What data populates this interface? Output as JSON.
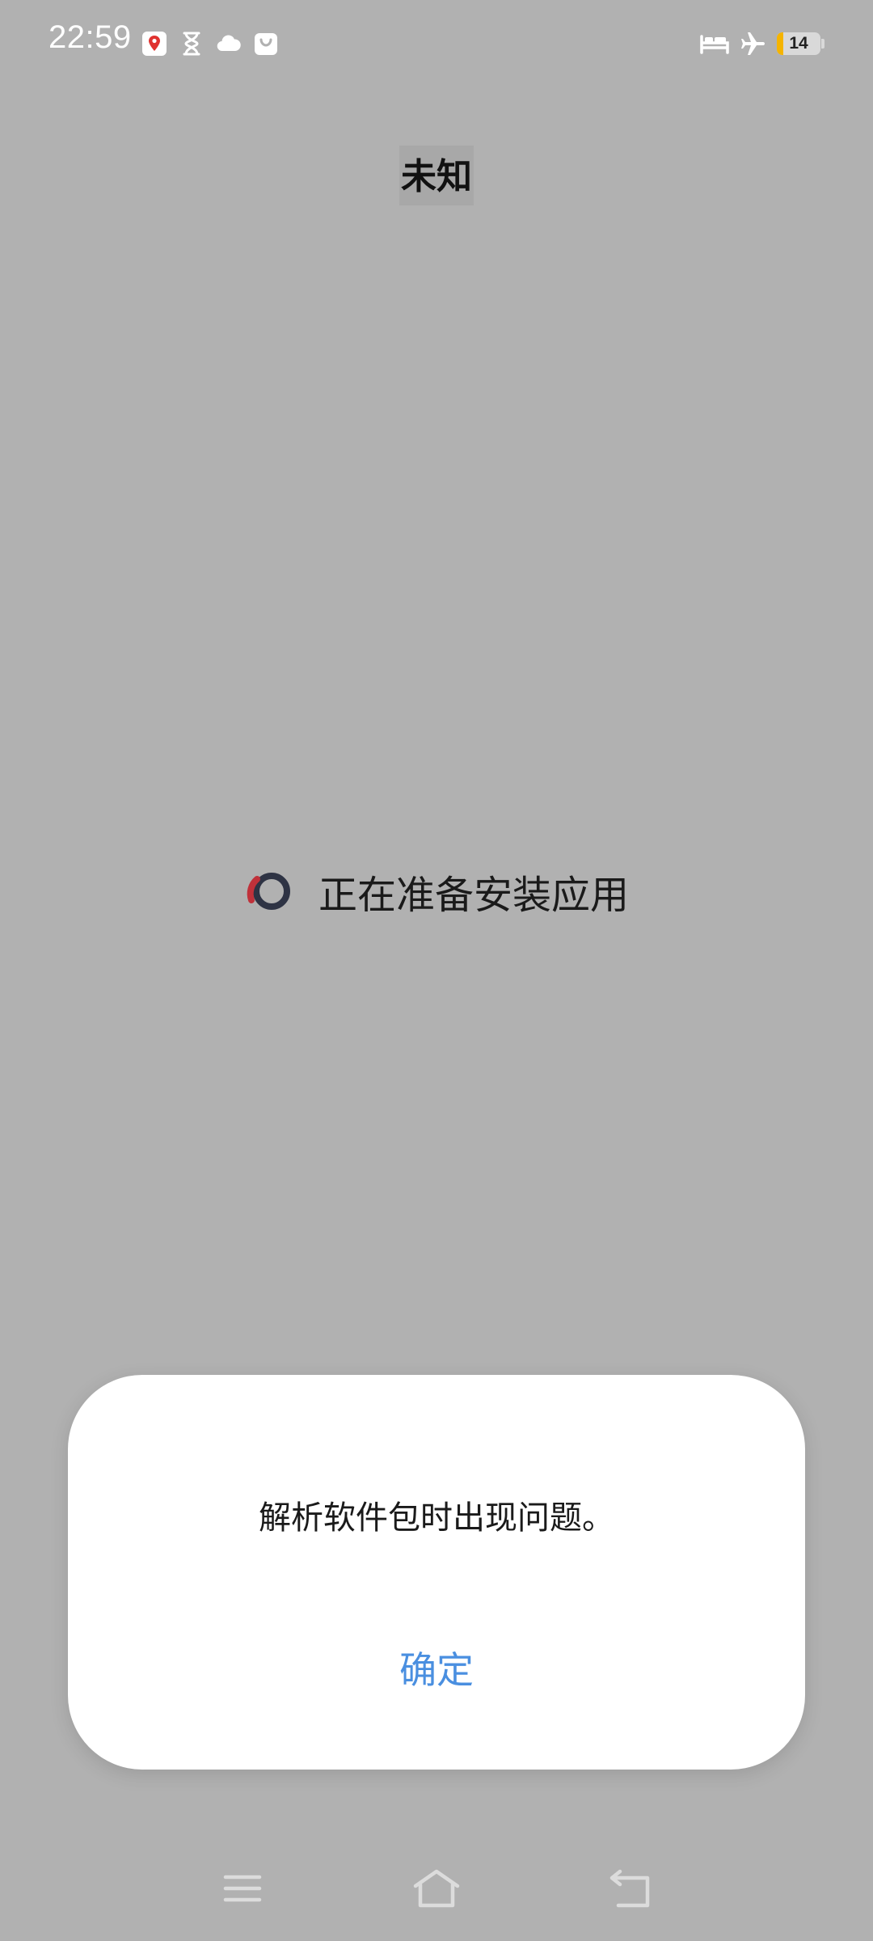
{
  "status_bar": {
    "time": "22:59",
    "left_icons": [
      "maps-pin-icon",
      "hourglass-icon",
      "cloud-icon",
      "shopping-bag-icon"
    ],
    "right_icons": [
      "bed-icon",
      "airplane-mode-icon",
      "battery-icon"
    ],
    "battery_level": "14",
    "battery_color": "#f5b400"
  },
  "app": {
    "title": "未知"
  },
  "progress": {
    "text": "正在准备安装应用",
    "spinner_colors": [
      "#2e3344",
      "#c0313a"
    ]
  },
  "dialog": {
    "message": "解析软件包时出现问题。",
    "confirm_label": "确定",
    "accent_color": "#4a8fe0"
  },
  "nav_bar": {
    "buttons": [
      "menu-icon",
      "home-icon",
      "back-icon"
    ]
  }
}
